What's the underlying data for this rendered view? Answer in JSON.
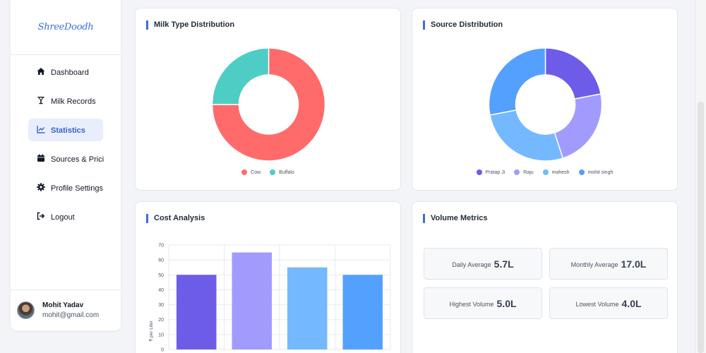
{
  "brand": {
    "name": "ShreeDoodh"
  },
  "sidebar": {
    "items": [
      {
        "label": "Dashboard",
        "icon": "home-icon"
      },
      {
        "label": "Milk Records",
        "icon": "glass-icon"
      },
      {
        "label": "Statistics",
        "icon": "chart-line-icon",
        "active": true
      },
      {
        "label": "Sources & Prici",
        "icon": "calendar-icon"
      },
      {
        "label": "Profile Settings",
        "icon": "gear-icon"
      },
      {
        "label": "Logout",
        "icon": "logout-icon"
      }
    ]
  },
  "user": {
    "name": "Mohit Yadav",
    "email": "mohit@gmail.com"
  },
  "cards": {
    "milk_type": {
      "title": "Milk Type Distribution"
    },
    "source": {
      "title": "Source Distribution"
    },
    "cost": {
      "title": "Cost Analysis"
    },
    "volume": {
      "title": "Volume Metrics"
    }
  },
  "colors": {
    "accent": "#3b6fd8",
    "cow": "#ff6b6b",
    "buffalo": "#4ecdc4"
  },
  "chart_data": [
    {
      "type": "pie",
      "title": "Milk Type Distribution",
      "donut": true,
      "labels": [
        "Cow",
        "Buffalo"
      ],
      "values": [
        75,
        25
      ],
      "colors": [
        "#ff6b6b",
        "#4ecdc4"
      ],
      "legend": "bottom"
    },
    {
      "type": "pie",
      "title": "Source Distribution",
      "donut": true,
      "labels": [
        "Pratap Ji",
        "Raju",
        "mahesh",
        "mohit singh"
      ],
      "values": [
        22,
        23,
        27,
        28
      ],
      "colors": [
        "#6c5ce7",
        "#a29bfe",
        "#74b9ff",
        "#54a0ff"
      ],
      "legend": "bottom"
    },
    {
      "type": "bar",
      "title": "Cost Analysis",
      "ylabel": "₹ per Liter",
      "ylim": [
        0,
        70
      ],
      "yticks": [
        0,
        10,
        20,
        30,
        40,
        50,
        60,
        70
      ],
      "values": [
        50,
        65,
        55,
        50
      ],
      "colors": [
        "#6c5ce7",
        "#a29bfe",
        "#74b9ff",
        "#54a0ff"
      ],
      "grid": true
    }
  ],
  "volume_metrics": [
    {
      "label": "Daily Average",
      "value": "5.7L"
    },
    {
      "label": "Monthly Average",
      "value": "17.0L"
    },
    {
      "label": "Highest Volume",
      "value": "5.0L"
    },
    {
      "label": "Lowest Volume",
      "value": "4.0L"
    }
  ]
}
